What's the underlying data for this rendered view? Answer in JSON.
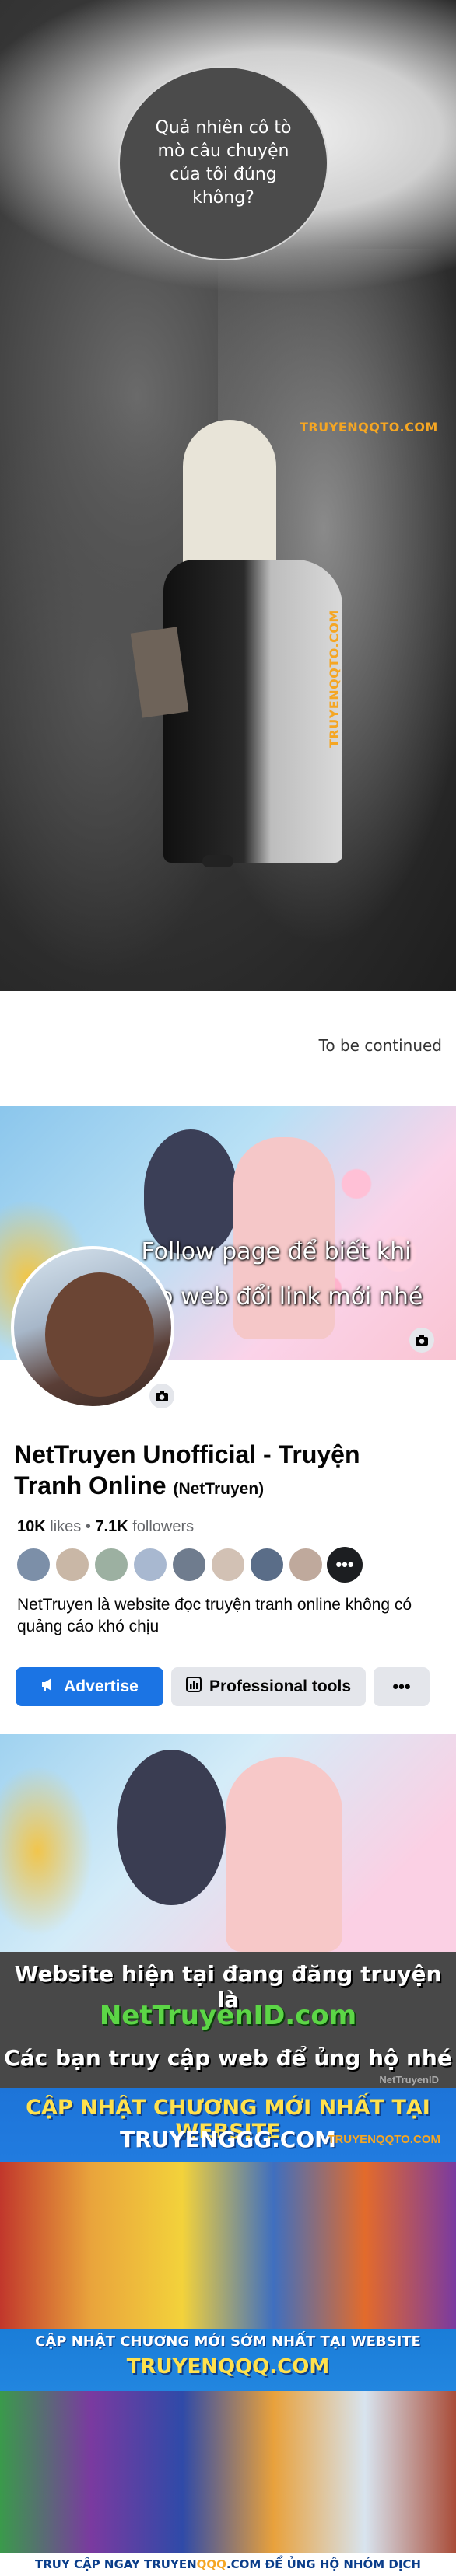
{
  "manga": {
    "bubble_text": "Quả nhiên cô tò mò câu chuyện của tôi đúng không?",
    "watermark_top": "TRUYENQQTO.COM",
    "watermark_mid": "TRUYENQQTO.COM"
  },
  "continued": {
    "text": "To be continued"
  },
  "facebook": {
    "caption_line1": "Follow page để biết khi",
    "caption_line2": "nào web đổi link mới nhé",
    "page_name": "NetTruyen Unofficial - Truyện Tranh Online",
    "handle": "(NetTruyen)",
    "likes_value": "10K",
    "likes_label": "likes",
    "separator": "•",
    "followers_value": "7.1K",
    "followers_label": "followers",
    "more_label": "•••",
    "description": "NetTruyen là website đọc truyện tranh online không có quảng cáo khó chịu",
    "advertise_label": "Advertise",
    "pro_tools_label": "Professional tools",
    "more_button_label": "•••",
    "friend_colors": [
      "#7c8fa8",
      "#c9b7a6",
      "#9cb0a1",
      "#a8b8d0",
      "#6f7c8e",
      "#d2c1b4",
      "#5a6d88",
      "#bfa99c"
    ],
    "accent_color": "#1b74e4"
  },
  "ad": {
    "line1": "Website hiện tại đang đăng truyện là",
    "line2": "NetTruyenID.com",
    "line3": "Các bạn truy cập web để ủng hộ nhé",
    "tag": "NetTruyenID",
    "banner2_line1": "CẬP NHẬT CHƯƠNG MỚI NHẤT TẠI WEBSITE",
    "banner2_line2": "TRUYENGGG.COM",
    "banner2_watermark": "TRUYENQQTO.COM",
    "banner3_line1": "CẬP NHẬT CHƯƠNG MỚI SỚM NHẤT TẠI WEBSITE",
    "banner3_line2": "TRUYENQQQ.COM",
    "footer_pre": "TRUY CẬP NGAY TRUYEN",
    "footer_hl": "QQQ",
    "footer_post": ".COM ĐỂ ỦNG HỘ NHÓM DỊCH"
  }
}
